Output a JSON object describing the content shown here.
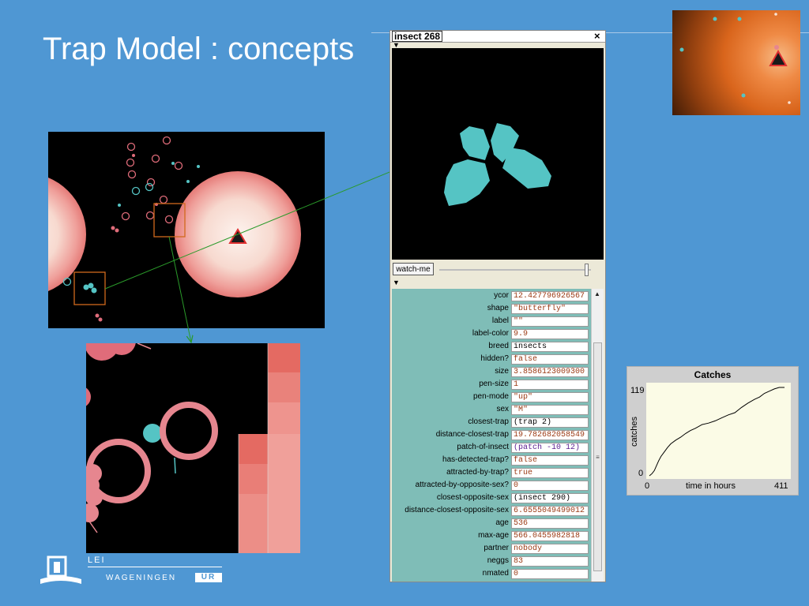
{
  "slide": {
    "title": "Trap Model : concepts"
  },
  "inspector": {
    "title": "insect 268",
    "close_glyph": "×",
    "watch_button_label": "watch-me",
    "variables": [
      {
        "name": "ycor",
        "value": "12.427796926567",
        "kind": "num"
      },
      {
        "name": "shape",
        "value": "\"butterfly\"",
        "kind": "str"
      },
      {
        "name": "label",
        "value": "\"\"",
        "kind": "str"
      },
      {
        "name": "label-color",
        "value": "9.9",
        "kind": "num"
      },
      {
        "name": "breed",
        "value": "insects",
        "kind": "obj"
      },
      {
        "name": "hidden?",
        "value": "false",
        "kind": "num"
      },
      {
        "name": "size",
        "value": "3.8586123009300",
        "kind": "num"
      },
      {
        "name": "pen-size",
        "value": "1",
        "kind": "num"
      },
      {
        "name": "pen-mode",
        "value": "\"up\"",
        "kind": "str"
      },
      {
        "name": "sex",
        "value": "\"M\"",
        "kind": "str"
      },
      {
        "name": "closest-trap",
        "value": "(trap 2)",
        "kind": "obj"
      },
      {
        "name": "distance-closest-trap",
        "value": "19.782682058549",
        "kind": "num"
      },
      {
        "name": "patch-of-insect",
        "value": "(patch -10 12)",
        "kind": "agent"
      },
      {
        "name": "has-detected-trap?",
        "value": "false",
        "kind": "num"
      },
      {
        "name": "attracted-by-trap?",
        "value": "true",
        "kind": "num"
      },
      {
        "name": "attracted-by-opposite-sex?",
        "value": "0",
        "kind": "num"
      },
      {
        "name": "closest-opposite-sex",
        "value": "(insect 290)",
        "kind": "obj"
      },
      {
        "name": "distance-closest-opposite-sex",
        "value": "6.6555049499012",
        "kind": "num"
      },
      {
        "name": "age",
        "value": "536",
        "kind": "num"
      },
      {
        "name": "max-age",
        "value": "566.0455982818",
        "kind": "num"
      },
      {
        "name": "partner",
        "value": "nobody",
        "kind": "num"
      },
      {
        "name": "neggs",
        "value": "83",
        "kind": "num"
      },
      {
        "name": "nmated",
        "value": "0",
        "kind": "num"
      }
    ]
  },
  "plot": {
    "title": "Catches",
    "ylabel": "catches",
    "xlabel": "time in hours",
    "y_max_label": "119",
    "y_min_label": "0",
    "x_min_label": "0",
    "x_max_label": "411"
  },
  "chart_data": {
    "type": "line",
    "title": "Catches",
    "xlabel": "time in hours",
    "ylabel": "catches",
    "xlim": [
      0,
      411
    ],
    "ylim": [
      0,
      119
    ],
    "series": [
      {
        "x": [
          0,
          8,
          15,
          20,
          28,
          35,
          45,
          55,
          65,
          80,
          95,
          110,
          125,
          140,
          160,
          180,
          200,
          220,
          240,
          260,
          280,
          300,
          320,
          335,
          350,
          365,
          380,
          395,
          411
        ],
        "y": [
          0,
          3,
          7,
          12,
          20,
          26,
          32,
          38,
          43,
          48,
          52,
          57,
          61,
          64,
          69,
          71,
          74,
          78,
          82,
          85,
          92,
          98,
          103,
          106,
          111,
          114,
          117,
          119,
          119
        ]
      }
    ]
  },
  "logo": {
    "lei": "LEI",
    "wageningen": "WAGENINGEN",
    "ur": "UR"
  },
  "colors": {
    "background": "#4f97d3",
    "trap_glow": "#f8e4dc",
    "insect_turquoise": "#55c4c4",
    "insect_pink": "#e06c7a",
    "highlight_box": "#d0691c",
    "arrow": "#2a9a2a"
  }
}
